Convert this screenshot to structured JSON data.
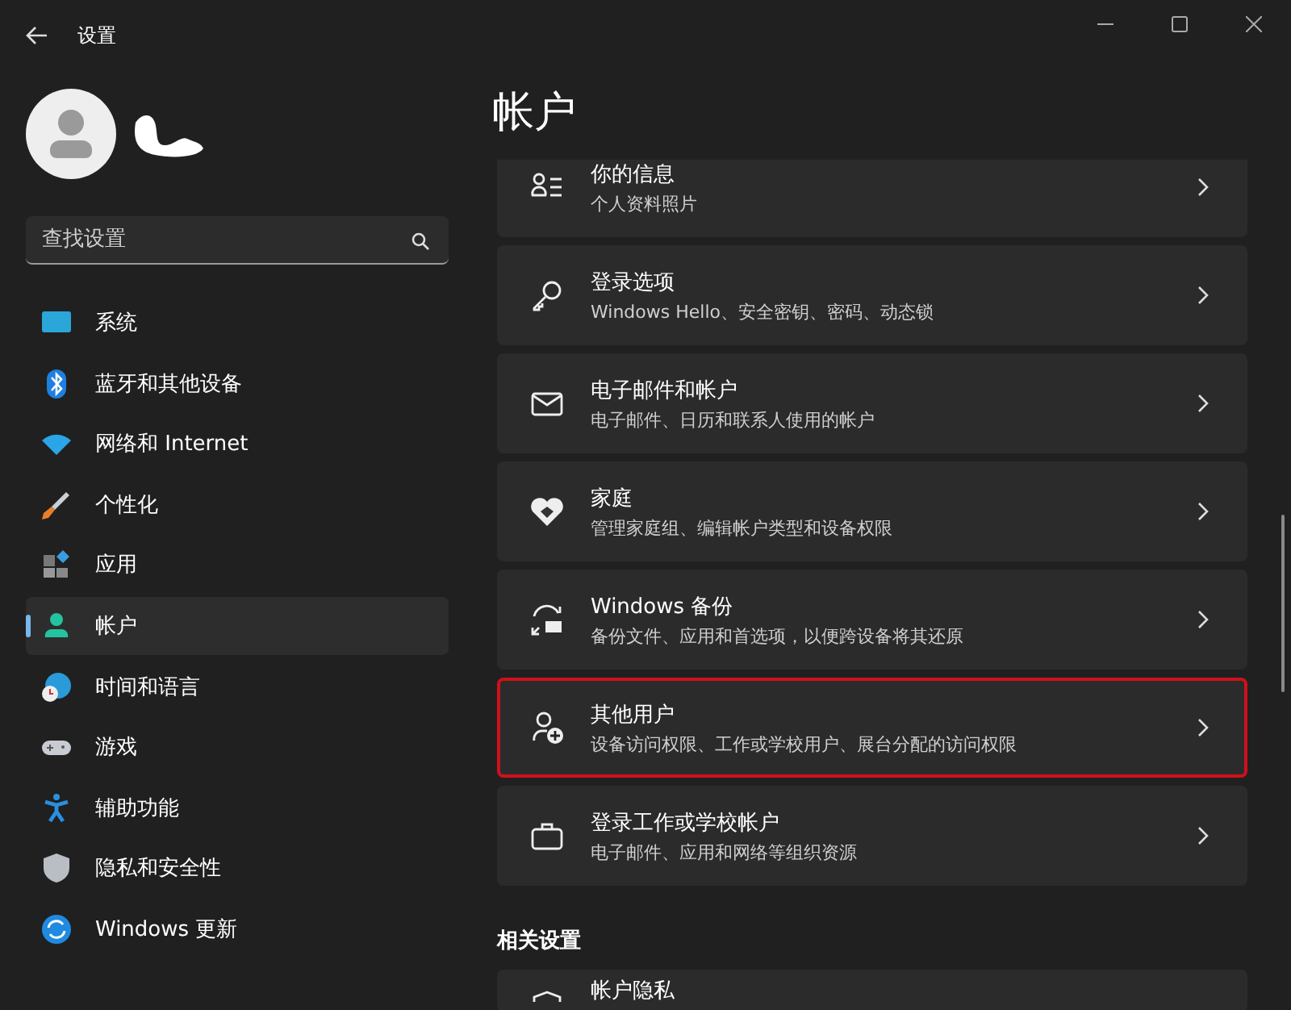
{
  "window": {
    "title": "设置"
  },
  "profile": {
    "redacted": true
  },
  "search": {
    "placeholder": "查找设置"
  },
  "nav": [
    {
      "kind": "system",
      "label": "系统",
      "selected": false
    },
    {
      "kind": "bluetooth",
      "label": "蓝牙和其他设备",
      "selected": false
    },
    {
      "kind": "network",
      "label": "网络和 Internet",
      "selected": false
    },
    {
      "kind": "personalize",
      "label": "个性化",
      "selected": false
    },
    {
      "kind": "apps",
      "label": "应用",
      "selected": false
    },
    {
      "kind": "accounts",
      "label": "帐户",
      "selected": true
    },
    {
      "kind": "time",
      "label": "时间和语言",
      "selected": false
    },
    {
      "kind": "gaming",
      "label": "游戏",
      "selected": false
    },
    {
      "kind": "accessibility",
      "label": "辅助功能",
      "selected": false
    },
    {
      "kind": "privacy",
      "label": "隐私和安全性",
      "selected": false
    },
    {
      "kind": "update",
      "label": "Windows 更新",
      "selected": false
    }
  ],
  "page_title": "帐户",
  "cards": [
    {
      "kind": "info",
      "title": "你的信息",
      "subtitle": "个人资料照片",
      "highlighted": false
    },
    {
      "kind": "key",
      "title": "登录选项",
      "subtitle": "Windows Hello、安全密钥、密码、动态锁",
      "highlighted": false
    },
    {
      "kind": "mail",
      "title": "电子邮件和帐户",
      "subtitle": "电子邮件、日历和联系人使用的帐户",
      "highlighted": false
    },
    {
      "kind": "family",
      "title": "家庭",
      "subtitle": "管理家庭组、编辑帐户类型和设备权限",
      "highlighted": false
    },
    {
      "kind": "backup",
      "title": "Windows 备份",
      "subtitle": "备份文件、应用和首选项，以便跨设备将其还原",
      "highlighted": false
    },
    {
      "kind": "users",
      "title": "其他用户",
      "subtitle": "设备访问权限、工作或学校用户、展台分配的访问权限",
      "highlighted": true
    },
    {
      "kind": "work",
      "title": "登录工作或学校帐户",
      "subtitle": "电子邮件、应用和网络等组织资源",
      "highlighted": false
    }
  ],
  "related": {
    "heading": "相关设置",
    "items": [
      {
        "title": "帐户隐私"
      }
    ]
  }
}
